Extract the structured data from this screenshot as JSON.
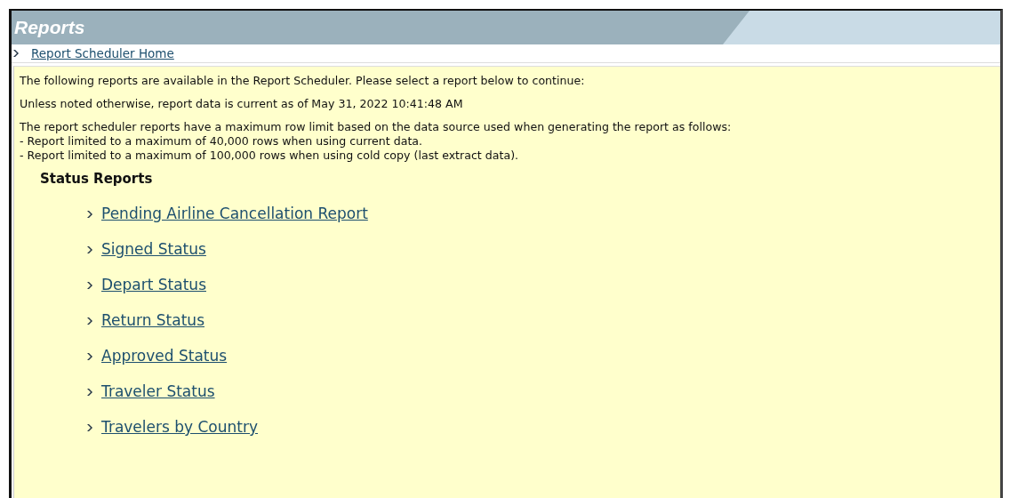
{
  "header": {
    "title": "Reports"
  },
  "home_link": {
    "label": "Report Scheduler Home"
  },
  "intro": [
    "The following reports are available in the Report Scheduler. Please select a report below to continue:",
    "Unless noted otherwise, report data is current as of May 31, 2022 10:41:48 AM"
  ],
  "limits": {
    "text": "The report scheduler reports have a maximum row limit based on the data source used when generating the report as follows:",
    "items": [
      "- Report limited to a maximum of 40,000 rows when using current data.",
      "- Report limited to a maximum of 100,000 rows when using cold copy (last extract data)."
    ]
  },
  "section": {
    "title": "Status Reports",
    "links": [
      "Pending Airline Cancellation Report",
      "Signed Status",
      "Depart Status",
      "Return Status",
      "Approved Status",
      "Traveler Status",
      "Travelers by Country"
    ]
  }
}
